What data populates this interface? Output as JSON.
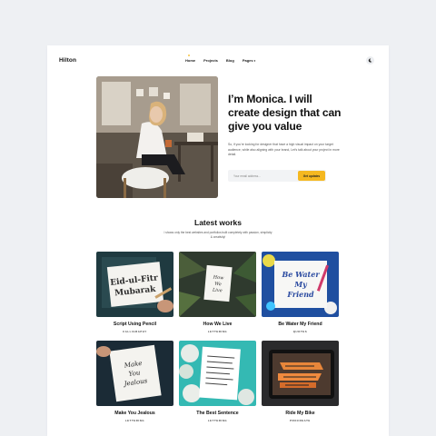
{
  "nav": {
    "logo": "Hilton",
    "links": [
      "Home",
      "Projects",
      "Blog",
      "Pages"
    ],
    "pages_chevron_icon": "chevron-down-icon",
    "theme_icon": "moon-icon"
  },
  "hero": {
    "title": "I’m Monica. I will create design that can give you value",
    "description": "So, if you're looking for designer that have a high visual impact on your target audience, while also aligning with your brand, Let's talk about your project in more detail.",
    "email_placeholder": "Your email address...",
    "button": "Get updates"
  },
  "works": {
    "title": "Latest works",
    "description": "I shows only the best websites and portfolios built completely with passion, simplicity & creativity!",
    "items": [
      {
        "title": "Script Using Pencil",
        "category": "CALLIGRAPHY",
        "thumb_text": "Eid-ul-Fitr Mubarak"
      },
      {
        "title": "How We Live",
        "category": "LETTERING",
        "thumb_text": "How We Live"
      },
      {
        "title": "Be Water My Friend",
        "category": "QUOTES",
        "thumb_text": "Be Water My Friend"
      },
      {
        "title": "Make You Jealous",
        "category": "LETTERING",
        "thumb_text": "Make You Jealous"
      },
      {
        "title": "The Best Sentence",
        "category": "LETTERING",
        "thumb_text": ""
      },
      {
        "title": "Ride My Bike",
        "category": "PROCREATE",
        "thumb_text": ""
      }
    ]
  },
  "colors": {
    "accent": "#f5b820",
    "page_bg": "#eef0f3",
    "card_bg": "#ffffff"
  }
}
